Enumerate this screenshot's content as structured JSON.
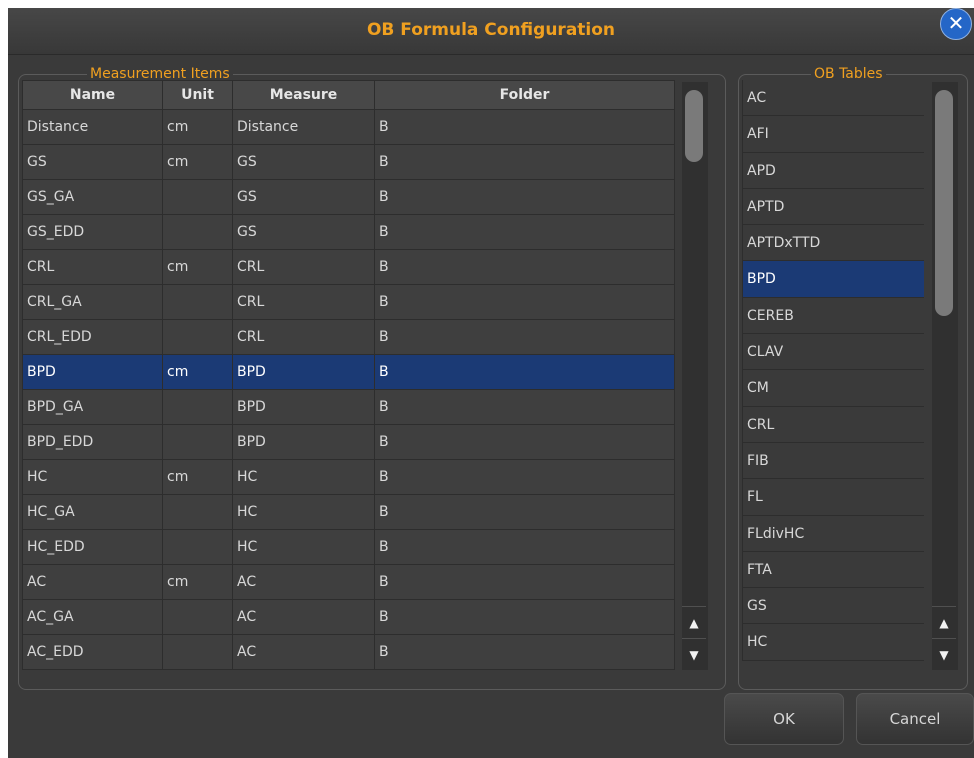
{
  "dialog": {
    "title": "OB Formula Configuration",
    "close_label": "✕"
  },
  "measurement_items": {
    "legend": "Measurement Items",
    "columns": [
      "Name",
      "Unit",
      "Measure",
      "Folder"
    ],
    "rows": [
      {
        "name": "Distance",
        "unit": "cm",
        "measure": "Distance",
        "folder": "B"
      },
      {
        "name": "GS",
        "unit": "cm",
        "measure": "GS",
        "folder": "B"
      },
      {
        "name": "GS_GA",
        "unit": "",
        "measure": "GS",
        "folder": "B"
      },
      {
        "name": "GS_EDD",
        "unit": "",
        "measure": "GS",
        "folder": "B"
      },
      {
        "name": "CRL",
        "unit": "cm",
        "measure": "CRL",
        "folder": "B"
      },
      {
        "name": "CRL_GA",
        "unit": "",
        "measure": "CRL",
        "folder": "B"
      },
      {
        "name": "CRL_EDD",
        "unit": "",
        "measure": "CRL",
        "folder": "B"
      },
      {
        "name": "BPD",
        "unit": "cm",
        "measure": "BPD",
        "folder": "B",
        "selected": true
      },
      {
        "name": "BPD_GA",
        "unit": "",
        "measure": "BPD",
        "folder": "B"
      },
      {
        "name": "BPD_EDD",
        "unit": "",
        "measure": "BPD",
        "folder": "B"
      },
      {
        "name": "HC",
        "unit": "cm",
        "measure": "HC",
        "folder": "B"
      },
      {
        "name": "HC_GA",
        "unit": "",
        "measure": "HC",
        "folder": "B"
      },
      {
        "name": "HC_EDD",
        "unit": "",
        "measure": "HC",
        "folder": "B"
      },
      {
        "name": "AC",
        "unit": "cm",
        "measure": "AC",
        "folder": "B"
      },
      {
        "name": "AC_GA",
        "unit": "",
        "measure": "AC",
        "folder": "B"
      },
      {
        "name": "AC_EDD",
        "unit": "",
        "measure": "AC",
        "folder": "B"
      }
    ]
  },
  "ob_tables": {
    "legend": "OB Tables",
    "items": [
      "AC",
      "AFI",
      "APD",
      "APTD",
      "APTDxTTD",
      "BPD",
      "CEREB",
      "CLAV",
      "CM",
      "CRL",
      "FIB",
      "FL",
      "FLdivHC",
      "FTA",
      "GS",
      "HC"
    ],
    "selected": "BPD"
  },
  "scroll_arrows": {
    "up": "▲",
    "down": "▼"
  },
  "buttons": {
    "ok": "OK",
    "cancel": "Cancel"
  },
  "colors": {
    "accent": "#f0a020",
    "selection": "#1b3a75",
    "close": "#2466c7"
  }
}
